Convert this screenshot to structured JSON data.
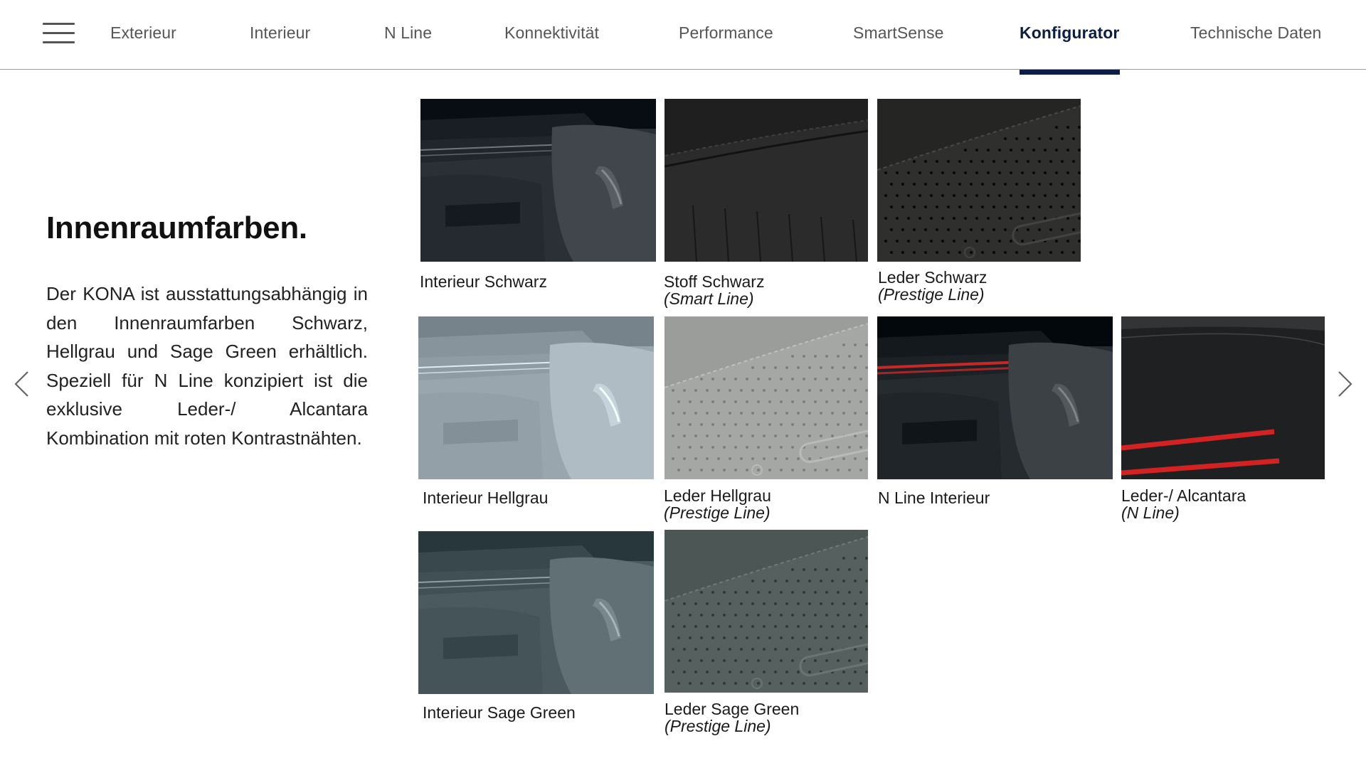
{
  "nav": {
    "items": [
      {
        "label": "Exterieur",
        "active": false
      },
      {
        "label": "Interieur",
        "active": false
      },
      {
        "label": "N Line",
        "active": false
      },
      {
        "label": "Konnektivität",
        "active": false
      },
      {
        "label": "Performance",
        "active": false
      },
      {
        "label": "SmartSense",
        "active": false
      },
      {
        "label": "Konfigurator",
        "active": true
      },
      {
        "label": "Technische Daten",
        "active": false
      }
    ],
    "menu_icon": "hamburger-menu-icon",
    "accent_color": "#0b1e44"
  },
  "section": {
    "title": "Innenraumfarben.",
    "description": "Der KONA ist ausstattungsabhängig in den Innenraumfarben Schwarz, Hellgrau und Sage Green erhältlich. Speziell für N Line konzipiert ist die exklusive Leder-/ Alcantara Kombination mit roten Kontrastnähten."
  },
  "arrows": {
    "prev_icon": "chevron-left-icon",
    "next_icon": "chevron-right-icon"
  },
  "swatches": [
    {
      "label": "Interieur Schwarz",
      "sub": "",
      "kind": "interior",
      "color": "#2b3036"
    },
    {
      "label": "Stoff Schwarz",
      "sub": "(Smart Line)",
      "kind": "fabric",
      "color": "#2a2b2a"
    },
    {
      "label": "Leder Schwarz",
      "sub": "(Prestige Line)",
      "kind": "leather",
      "color": "#2f302e"
    },
    {
      "label": "Interieur Hellgrau",
      "sub": "",
      "kind": "interior",
      "color": "#9aa6ad"
    },
    {
      "label": "Leder Hellgrau",
      "sub": "(Prestige Line)",
      "kind": "leather",
      "color": "#a5a7a4"
    },
    {
      "label": "N Line Interieur",
      "sub": "",
      "kind": "interior",
      "color": "#262b30"
    },
    {
      "label": "Leder-/ Alcantara",
      "sub": "(N Line)",
      "kind": "alcantara",
      "color": "#1f2022"
    },
    {
      "label": "Interieur Sage Green",
      "sub": "",
      "kind": "interior",
      "color": "#4a5a5e"
    },
    {
      "label": "Leder Sage Green",
      "sub": "(Prestige Line)",
      "kind": "leather",
      "color": "#56615f"
    }
  ]
}
